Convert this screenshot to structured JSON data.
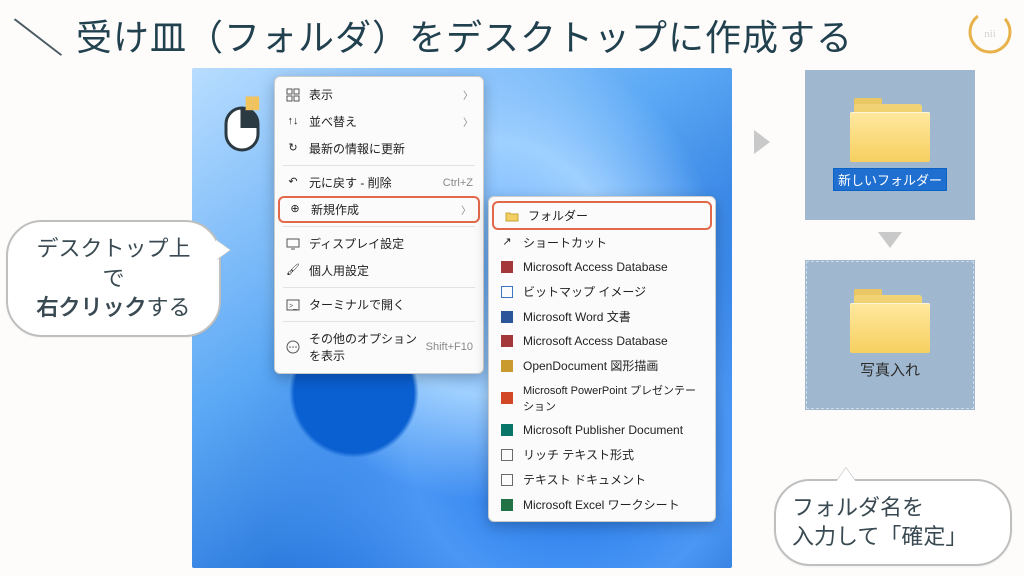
{
  "title": "受け皿（フォルダ）をデスクトップに作成する",
  "bubble_left_line1": "デスクトップ上で",
  "bubble_left_line2_bold": "右クリック",
  "bubble_left_line2_rest": "する",
  "context_menu": {
    "view": "表示",
    "sort": "並べ替え",
    "refresh": "最新の情報に更新",
    "undo": "元に戻す - 削除",
    "undo_shortcut": "Ctrl+Z",
    "new": "新規作成",
    "display": "ディスプレイ設定",
    "personalize": "個人用設定",
    "terminal": "ターミナルで開く",
    "more": "その他のオプションを表示",
    "more_shortcut": "Shift+F10"
  },
  "submenu": {
    "folder": "フォルダー",
    "shortcut": "ショートカット",
    "access1": "Microsoft Access Database",
    "bitmap": "ビットマップ イメージ",
    "word": "Microsoft Word 文書",
    "access2": "Microsoft Access Database",
    "odg": "OpenDocument 図形描画",
    "ppt": "Microsoft PowerPoint プレゼンテーション",
    "pub": "Microsoft Publisher Document",
    "rtf": "リッチ テキスト形式",
    "txt": "テキスト ドキュメント",
    "xls": "Microsoft Excel ワークシート"
  },
  "folder_new_name": "新しいフォルダー",
  "folder_renamed": "写真入れ",
  "bubble_right_line1": "フォルダ名を",
  "bubble_right_line2": "入力して「確定」"
}
